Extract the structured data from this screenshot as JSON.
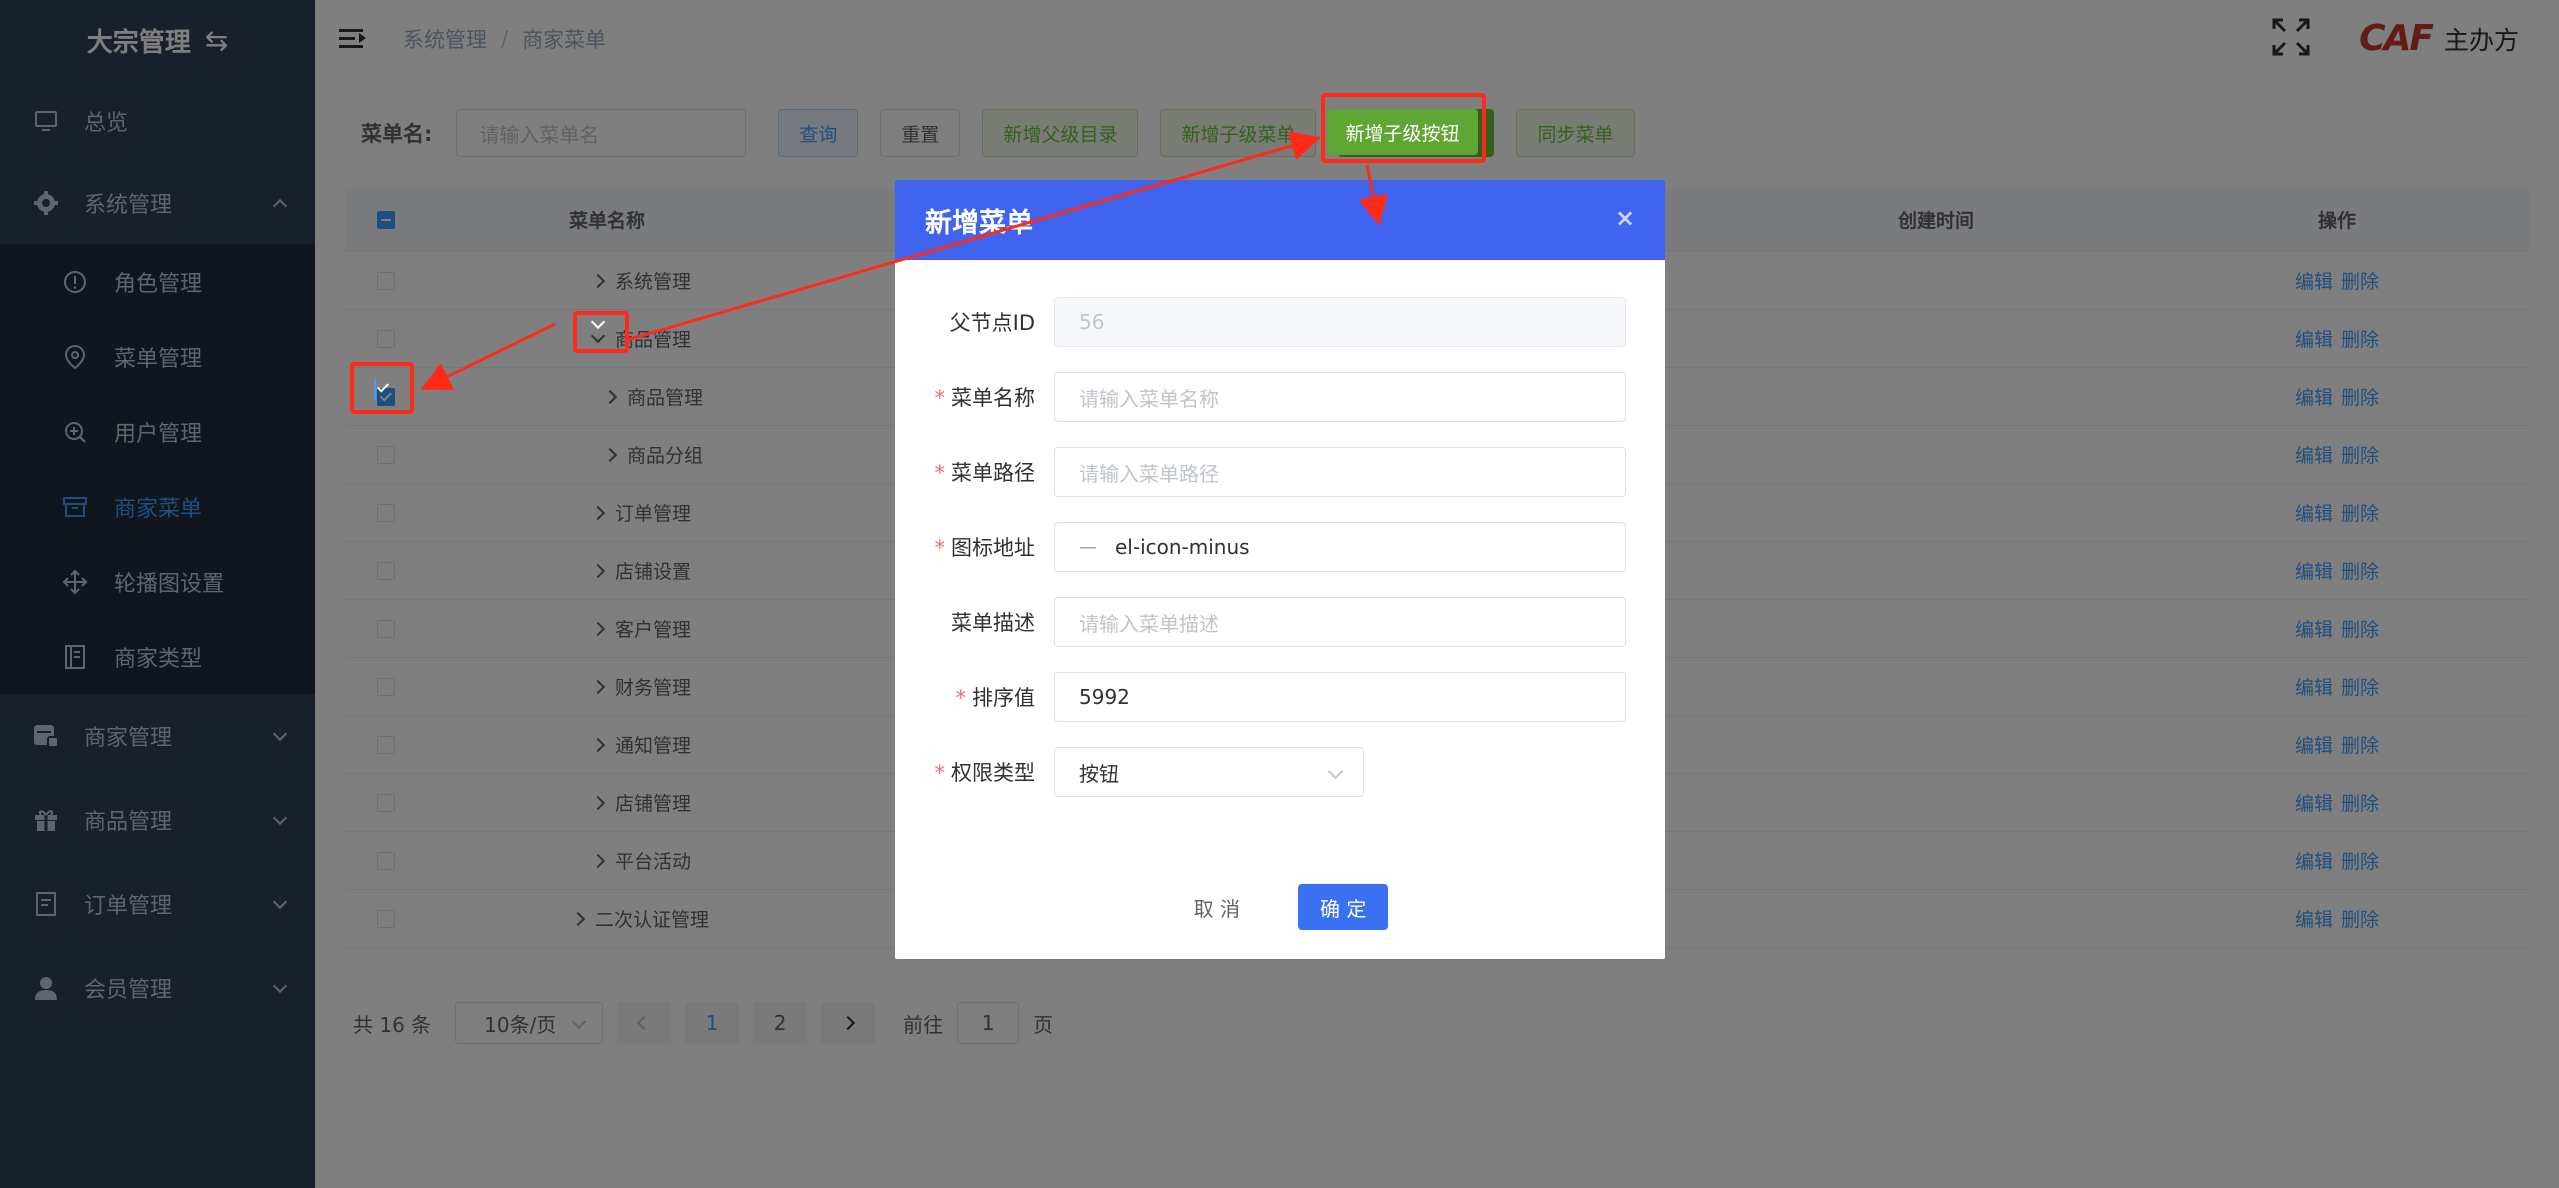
{
  "sidebar": {
    "title": "大宗管理",
    "swap_icon": "⇆",
    "items": [
      {
        "label": "总览",
        "icon": "monitor-icon"
      },
      {
        "label": "系统管理",
        "icon": "gear-icon"
      },
      {
        "label": "商家管理",
        "icon": "store-icon"
      },
      {
        "label": "商品管理",
        "icon": "gift-icon"
      },
      {
        "label": "订单管理",
        "icon": "document-icon"
      },
      {
        "label": "会员管理",
        "icon": "user-icon"
      }
    ],
    "subitems": [
      {
        "label": "角色管理",
        "icon": "alert-circle-icon"
      },
      {
        "label": "菜单管理",
        "icon": "location-icon"
      },
      {
        "label": "用户管理",
        "icon": "zoom-icon"
      },
      {
        "label": "商家菜单",
        "icon": "box-icon",
        "active": true
      },
      {
        "label": "轮播图设置",
        "icon": "move-icon"
      },
      {
        "label": "商家类型",
        "icon": "notebook-icon"
      }
    ]
  },
  "header": {
    "breadcrumb": [
      "系统管理",
      "商家菜单"
    ],
    "breadcrumb_sep": "/",
    "logo_text": "CAF",
    "organizer": "主办方"
  },
  "search": {
    "label": "菜单名:",
    "placeholder": "请输入菜单名",
    "query_btn": "查询",
    "reset_btn": "重置",
    "add_parent_btn": "新增父级目录",
    "add_child_menu_btn": "新增子级菜单",
    "add_child_button_btn": "新增子级按钮",
    "sync_btn": "同步菜单"
  },
  "table": {
    "columns": {
      "name": "菜单名称",
      "created": "创建时间",
      "ops": "操作"
    },
    "rows": [
      {
        "name": "系统管理",
        "level": 1,
        "expanded": false,
        "checked": false
      },
      {
        "name": "商品管理",
        "level": 1,
        "expanded": true,
        "checked": false
      },
      {
        "name": "商品管理",
        "level": 2,
        "expanded": false,
        "checked": true
      },
      {
        "name": "商品分组",
        "level": 2,
        "expanded": false,
        "checked": false
      },
      {
        "name": "订单管理",
        "level": 1,
        "expanded": false,
        "checked": false
      },
      {
        "name": "店铺设置",
        "level": 1,
        "expanded": false,
        "checked": false
      },
      {
        "name": "客户管理",
        "level": 1,
        "expanded": false,
        "checked": false
      },
      {
        "name": "财务管理",
        "level": 1,
        "expanded": false,
        "checked": false
      },
      {
        "name": "通知管理",
        "level": 1,
        "expanded": false,
        "checked": false
      },
      {
        "name": "店铺管理",
        "level": 1,
        "expanded": false,
        "checked": false
      },
      {
        "name": "平台活动",
        "level": 1,
        "expanded": false,
        "checked": false
      },
      {
        "name": "二次认证管理",
        "level": 0,
        "expanded": false,
        "checked": false
      }
    ],
    "edit_label": "编辑",
    "delete_label": "删除"
  },
  "pagination": {
    "total": "共 16 条",
    "page_size": "10条/页",
    "pages": [
      "1",
      "2"
    ],
    "current": "1",
    "goto_label": "前往",
    "goto_value": "1",
    "page_unit": "页"
  },
  "dialog": {
    "title": "新增菜单",
    "close": "×",
    "fields": [
      {
        "label": "父节点ID",
        "required": false,
        "value": "56",
        "placeholder": "",
        "type": "disabled"
      },
      {
        "label": "菜单名称",
        "required": true,
        "value": "",
        "placeholder": "请输入菜单名称",
        "type": "input"
      },
      {
        "label": "菜单路径",
        "required": true,
        "value": "",
        "placeholder": "请输入菜单路径",
        "type": "input"
      },
      {
        "label": "图标地址",
        "required": true,
        "value": "el-icon-minus",
        "placeholder": "",
        "type": "icon"
      },
      {
        "label": "菜单描述",
        "required": false,
        "value": "",
        "placeholder": "请输入菜单描述",
        "type": "input"
      },
      {
        "label": "排序值",
        "required": true,
        "value": "5992",
        "placeholder": "",
        "type": "input"
      },
      {
        "label": "权限类型",
        "required": true,
        "value": "按钮",
        "placeholder": "",
        "type": "select"
      }
    ],
    "required_mark": "*",
    "cancel_btn": "取 消",
    "confirm_btn": "确 定"
  },
  "colors": {
    "sidebar_bg": "#304156",
    "active": "#409eff",
    "dialog_header": "#4063f0",
    "annotation": "#ff2a1a"
  }
}
